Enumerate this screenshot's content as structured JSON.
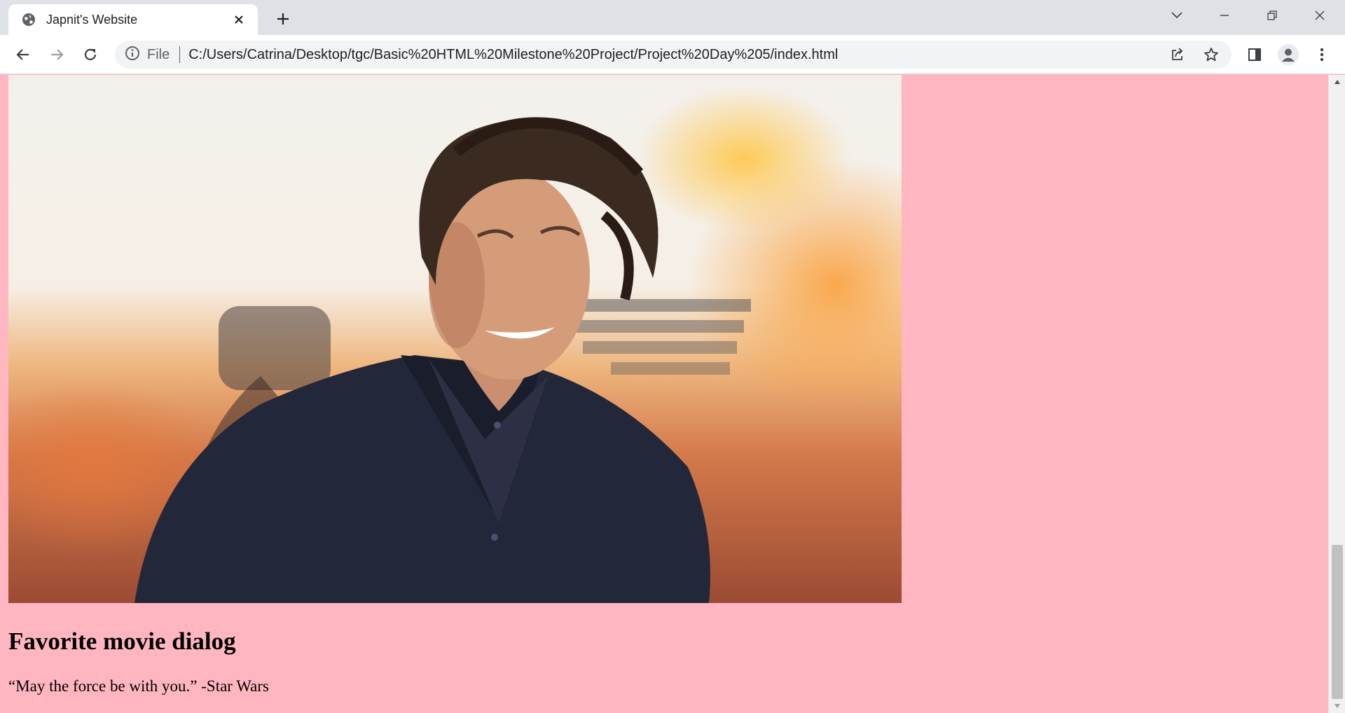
{
  "browser": {
    "tab": {
      "title": "Japnit's Website",
      "favicon": "globe-icon"
    },
    "toolbar": {
      "site_info_label": "File",
      "url": "C:/Users/Catrina/Desktop/tgc/Basic%20HTML%20Milestone%20Project/Project%20Day%205/index.html"
    },
    "icons": {
      "back": "arrow-left-icon",
      "forward": "arrow-right-icon",
      "reload": "reload-icon",
      "share": "share-icon",
      "bookmark": "star-icon",
      "side_panel": "side-panel-icon",
      "profile": "profile-icon",
      "menu": "more-vertical-icon"
    }
  },
  "page": {
    "background_color": "#ffb6c1",
    "image": {
      "description_icon": "photo"
    },
    "heading": "Favorite movie dialog",
    "quote": "“May the force be with you.” -Star Wars"
  },
  "scrollbar": {
    "position_fraction": 1.0
  }
}
